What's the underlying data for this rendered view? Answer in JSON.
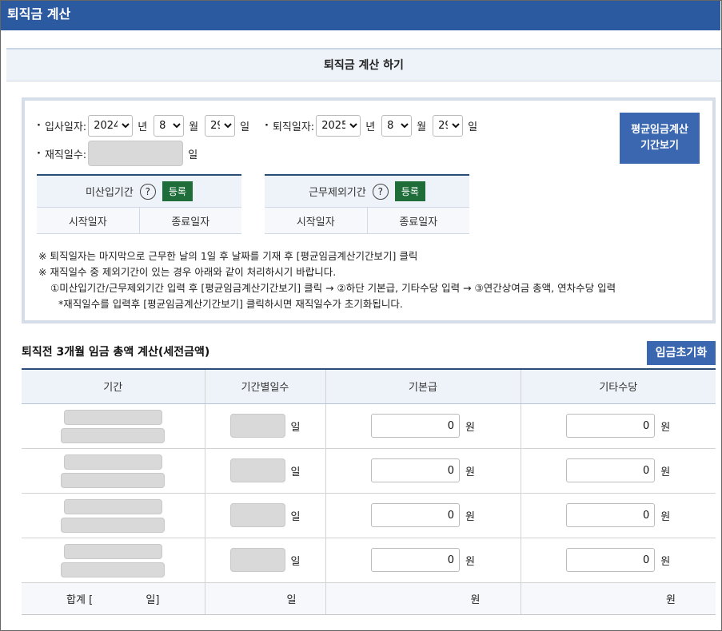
{
  "window": {
    "title": "퇴직금 계산"
  },
  "subheader": {
    "title": "퇴직금 계산 하기"
  },
  "form": {
    "hire": {
      "label": "입사일자:",
      "year": "2024",
      "month": "8",
      "day": "29"
    },
    "retire": {
      "label": "퇴직일자:",
      "year": "2025",
      "month": "8",
      "day": "29"
    },
    "units": {
      "year": "년",
      "month": "월",
      "day": "일"
    },
    "tenure": {
      "label": "재직일수:",
      "unit": "일"
    },
    "avg_wage_button": {
      "line1": "평균임금계산",
      "line2": "기간보기"
    },
    "unpaid_period": {
      "title": "미산입기간",
      "help": "?",
      "register": "등록",
      "start": "시작일자",
      "end": "종료일자"
    },
    "excluded_period": {
      "title": "근무제외기간",
      "help": "?",
      "register": "등록",
      "start": "시작일자",
      "end": "종료일자"
    }
  },
  "notes": [
    "※ 퇴직일자는 마지막으로 근무한 날의 1일 후 날짜를 기재 후 [평균임금계산기간보기] 클릭",
    "※ 재직일수 중 제외기간이 있는 경우 아래와 같이 처리하시기 바랍니다.",
    "①미산입기간/근무제외기간 입력 후 [평균임금계산기간보기] 클릭 → ②하단 기본급, 기타수당 입력 → ③연간상여금 총액, 연차수당 입력",
    "*재직일수를 입력후 [평균임금계산기간보기] 클릭하시면 재직일수가 초기화됩니다."
  ],
  "wage_section": {
    "title": "퇴직전 3개월 임금 총액 계산(세전금액)",
    "reset_button": "임금초기화",
    "columns": [
      "기간",
      "기간별일수",
      "기본급",
      "기타수당"
    ],
    "rows": [
      {
        "days_unit": "일",
        "base": "0",
        "base_unit": "원",
        "extra": "0",
        "extra_unit": "원"
      },
      {
        "days_unit": "일",
        "base": "0",
        "base_unit": "원",
        "extra": "0",
        "extra_unit": "원"
      },
      {
        "days_unit": "일",
        "base": "0",
        "base_unit": "원",
        "extra": "0",
        "extra_unit": "원"
      },
      {
        "days_unit": "일",
        "base": "0",
        "base_unit": "원",
        "extra": "0",
        "extra_unit": "원"
      }
    ],
    "total": {
      "label_open": "합계 [",
      "label_close": "일]",
      "days_unit": "일",
      "base_unit": "원",
      "extra_unit": "원"
    }
  }
}
